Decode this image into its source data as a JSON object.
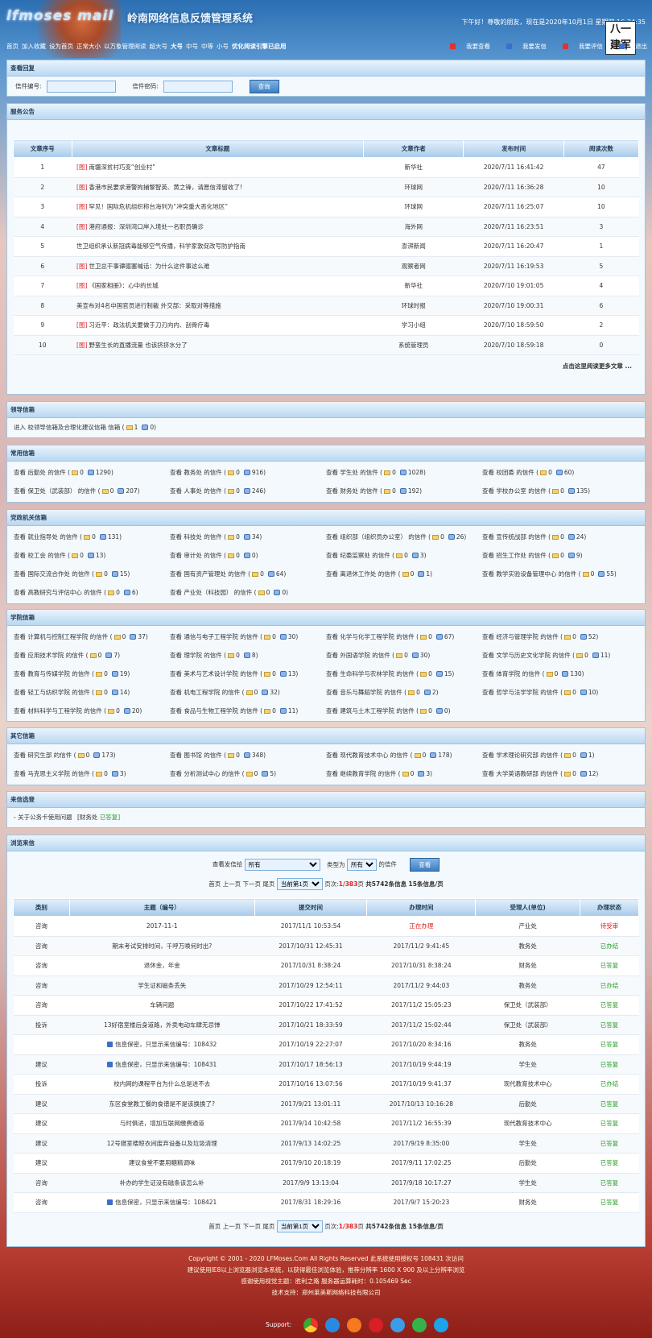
{
  "header": {
    "logo_text": "lfmoses mail",
    "system_title": "岭南网络信息反馈管理系统",
    "greeting": "下午好！尊敬的朋友，现在是2020年10月1日 星期四 16:34:35",
    "badge": "八一建军",
    "nav": [
      "首页",
      "加入收藏",
      "设为首页",
      "正常大小",
      "以万象管理阅读",
      "超大号",
      "大号",
      "中号",
      "中等",
      "小号",
      "优化阅读引擎已启用"
    ],
    "top_links": [
      "我要查看",
      "我要发信",
      "我要评信",
      "退出"
    ]
  },
  "search": {
    "title": "查看回复",
    "letter_no_label": "信件编号:",
    "password_label": "信件密码:",
    "button": "查询"
  },
  "notice": {
    "title": "服务公告",
    "columns": [
      "文章序号",
      "文章标题",
      "文章作者",
      "发布时间",
      "阅读次数"
    ],
    "rows": [
      {
        "no": "1",
        "tag": "[图]",
        "title": "南疆深贫村巧变“创业村”",
        "author": "新华社",
        "time": "2020/7/11 16:41:42",
        "reads": "47"
      },
      {
        "no": "2",
        "tag": "[图]",
        "title": "香港市民要求港警拘捕黎智英、黄之锋，请愿信滞留收了!",
        "author": "环球网",
        "time": "2020/7/11 16:36:28",
        "reads": "10"
      },
      {
        "no": "3",
        "tag": "[图]",
        "title": "罕见！国际危机组织称台海列为“冲突重大恶化地区”",
        "author": "环球网",
        "time": "2020/7/11 16:25:07",
        "reads": "10"
      },
      {
        "no": "4",
        "tag": "[图]",
        "title": "港府通报：深圳湾口岸入境处一名职员确诊",
        "author": "海外网",
        "time": "2020/7/11 16:23:51",
        "reads": "3"
      },
      {
        "no": "5",
        "tag": "",
        "title": "世卫组织承认新冠病毒能够空气传播，科学家敦促改写防护指南",
        "author": "澎湃新闻",
        "time": "2020/7/11 16:20:47",
        "reads": "1"
      },
      {
        "no": "6",
        "tag": "[图]",
        "title": "世卫总干事谭德塞喊话：为什么这件事这么难",
        "author": "观察者网",
        "time": "2020/7/11 16:19:53",
        "reads": "5"
      },
      {
        "no": "7",
        "tag": "[图]",
        "title": "《国家相册》：心中的长城",
        "author": "新华社",
        "time": "2020/7/10 19:01:05",
        "reads": "4"
      },
      {
        "no": "8",
        "tag": "",
        "title": "美宣布对4名中国官员进行制裁 外交部：采取对等措施",
        "author": "环球时报",
        "time": "2020/7/10 19:00:31",
        "reads": "6"
      },
      {
        "no": "9",
        "tag": "[图]",
        "title": "习近平：政法机关要做于刀刃向内、刮骨疗毒",
        "author": "学习小组",
        "time": "2020/7/10 18:59:50",
        "reads": "2"
      },
      {
        "no": "10",
        "tag": "[图]",
        "title": "野蛮生长的直播流量 也该挤挤水分了",
        "author": "系统管理员",
        "time": "2020/7/10 18:59:18",
        "reads": "0"
      }
    ],
    "more": "点击这里阅读更多文章 ..."
  },
  "leader": {
    "title": "领导信箱",
    "text": "进入 校领导信箱及合理化建议信箱 信箱 (",
    "mail": "1",
    "reply": "0"
  },
  "common": {
    "title": "常用信箱",
    "items": [
      {
        "name": "查看 后勤处 的信件 (",
        "a": "0",
        "b": "1290)"
      },
      {
        "name": "查看 教务处 的信件 (",
        "a": "0",
        "b": "916)"
      },
      {
        "name": "查看 学生处 的信件 (",
        "a": "0",
        "b": "1028)"
      },
      {
        "name": "查看 校团委 的信件 (",
        "a": "0",
        "b": "60)"
      },
      {
        "name": "查看 保卫处（武装部） 的信件 (",
        "a": "0",
        "b": "207)"
      },
      {
        "name": "查看 人事处 的信件 (",
        "a": "0",
        "b": "246)"
      },
      {
        "name": "查看 财务处 的信件 (",
        "a": "0",
        "b": "192)"
      },
      {
        "name": "查看 学校办公室 的信件 (",
        "a": "0",
        "b": "135)"
      }
    ]
  },
  "party": {
    "title": "党政机关信箱",
    "items": [
      {
        "name": "查看 就业指导处 的信件 (",
        "a": "0",
        "b": "131)"
      },
      {
        "name": "查看 科技处 的信件 (",
        "a": "0",
        "b": "34)"
      },
      {
        "name": "查看 组织部（组织员办公室） 的信件 (",
        "a": "0",
        "b": "26)"
      },
      {
        "name": "查看 宣传统战部 的信件 (",
        "a": "0",
        "b": "24)"
      },
      {
        "name": "查看 校工会 的信件 (",
        "a": "0",
        "b": "13)"
      },
      {
        "name": "查看 审计处 的信件 (",
        "a": "0",
        "b": "0)"
      },
      {
        "name": "查看 纪委监察处 的信件 (",
        "a": "0",
        "b": "3)"
      },
      {
        "name": "查看 招生工作处 的信件 (",
        "a": "0",
        "b": "9)"
      },
      {
        "name": "查看 国际交流合作处 的信件 (",
        "a": "0",
        "b": "15)"
      },
      {
        "name": "查看 国有资产管理处 的信件 (",
        "a": "0",
        "b": "64)"
      },
      {
        "name": "查看 离退休工作处 的信件 (",
        "a": "0",
        "b": "1)"
      },
      {
        "name": "查看 教学实验设备管理中心 的信件 (",
        "a": "0",
        "b": "55)"
      },
      {
        "name": "查看 高教研究与评估中心 的信件 (",
        "a": "0",
        "b": "6)"
      },
      {
        "name": "查看 产业处（科技园） 的信件 (",
        "a": "0",
        "b": "0)"
      }
    ]
  },
  "college": {
    "title": "学院信箱",
    "items": [
      {
        "name": "查看 计算机与控制工程学院 的信件 (",
        "a": "0",
        "b": "37)"
      },
      {
        "name": "查看 通信与电子工程学院 的信件 (",
        "a": "0",
        "b": "30)"
      },
      {
        "name": "查看 化学与化学工程学院 的信件 (",
        "a": "0",
        "b": "67)"
      },
      {
        "name": "查看 经济与管理学院 的信件 (",
        "a": "0",
        "b": "52)"
      },
      {
        "name": "查看 应用技术学院 的信件 (",
        "a": "0",
        "b": "7)"
      },
      {
        "name": "查看 理学院 的信件 (",
        "a": "0",
        "b": "8)"
      },
      {
        "name": "查看 外国语学院 的信件 (",
        "a": "0",
        "b": "30)"
      },
      {
        "name": "查看 文学与历史文化学院 的信件 (",
        "a": "0",
        "b": "11)"
      },
      {
        "name": "查看 教育与传媒学院 的信件 (",
        "a": "0",
        "b": "19)"
      },
      {
        "name": "查看 美术与艺术设计学院 的信件 (",
        "a": "0",
        "b": "13)"
      },
      {
        "name": "查看 生命科学与农林学院 的信件 (",
        "a": "0",
        "b": "15)"
      },
      {
        "name": "查看 体育学院 的信件 (",
        "a": "0",
        "b": "130)"
      },
      {
        "name": "查看 轻工与纺织学院 的信件 (",
        "a": "0",
        "b": "14)"
      },
      {
        "name": "查看 机电工程学院 的信件 (",
        "a": "0",
        "b": "32)"
      },
      {
        "name": "查看 音乐与舞蹈学院 的信件 (",
        "a": "0",
        "b": "2)"
      },
      {
        "name": "查看 哲学与法学学院 的信件 (",
        "a": "0",
        "b": "10)"
      },
      {
        "name": "查看 材料科学与工程学院 的信件 (",
        "a": "0",
        "b": "20)"
      },
      {
        "name": "查看 食品与生物工程学院 的信件 (",
        "a": "0",
        "b": "11)"
      },
      {
        "name": "查看 建筑与土木工程学院 的信件 (",
        "a": "0",
        "b": "0)"
      }
    ]
  },
  "other": {
    "title": "其它信箱",
    "items": [
      {
        "name": "查看 研究生部 的信件 (",
        "a": "0",
        "b": "173)"
      },
      {
        "name": "查看 图书馆 的信件 (",
        "a": "0",
        "b": "348)"
      },
      {
        "name": "查看 现代教育技术中心 的信件 (",
        "a": "0",
        "b": "178)"
      },
      {
        "name": "查看 学术理论研究部 的信件 (",
        "a": "0",
        "b": "1)"
      },
      {
        "name": "查看 马克思主义学院 的信件 (",
        "a": "0",
        "b": "3)"
      },
      {
        "name": "查看 分析测试中心 的信件 (",
        "a": "0",
        "b": "5)"
      },
      {
        "name": "查看 继续教育学院 的信件 (",
        "a": "0",
        "b": "3)"
      },
      {
        "name": "查看 大学英语教研部 的信件 (",
        "a": "0",
        "b": "12)"
      }
    ]
  },
  "featured": {
    "title": "来信选登",
    "text": "- 关于公务卡使用问题",
    "dept": "[财务处",
    "status": "已答复]"
  },
  "browse": {
    "title": "浏览来信",
    "filter_label": "查看发信给",
    "filter_value": "所有",
    "type_label": "类型为",
    "type_value": "所有",
    "suffix": "的信件",
    "button": "查看",
    "pager": {
      "links": "首页 上一页 下一页 尾页",
      "select": "当前第1页",
      "page_label": "页次:",
      "page": "1/383",
      "page_unit": "页",
      "total": "共5742条信息",
      "per": "15条信息/页"
    },
    "columns": [
      "类别",
      "主题（编号）",
      "提交时间",
      "办理时间",
      "受理人(单位)",
      "办理状态"
    ],
    "rows": [
      {
        "type": "咨询",
        "lock": false,
        "subject": "2017-11-1",
        "submit": "2017/11/1 10:53:54",
        "handle": "正在办理",
        "handle_red": true,
        "dept": "产业处",
        "status": "待受审",
        "status_cls": "red"
      },
      {
        "type": "咨询",
        "lock": false,
        "subject": "期末考试安排时间，千呼万唤何时出?",
        "submit": "2017/10/31 12:45:31",
        "handle": "2017/11/2 9:41:45",
        "handle_red": false,
        "dept": "教务处",
        "status": "已办结",
        "status_cls": "green"
      },
      {
        "type": "咨询",
        "lock": false,
        "subject": "退休金，年金",
        "submit": "2017/10/31 8:38:24",
        "handle": "2017/10/31 8:38:24",
        "handle_red": false,
        "dept": "财务处",
        "status": "已答复",
        "status_cls": "green"
      },
      {
        "type": "咨询",
        "lock": false,
        "subject": "学生证和磁条丢失",
        "submit": "2017/10/29 12:54:11",
        "handle": "2017/11/2 9:44:03",
        "handle_red": false,
        "dept": "教务处",
        "status": "已办结",
        "status_cls": "green"
      },
      {
        "type": "咨询",
        "lock": false,
        "subject": "车辆问题",
        "submit": "2017/10/22 17:41:52",
        "handle": "2017/11/2 15:05:23",
        "handle_red": false,
        "dept": "保卫处（武装部）",
        "status": "已答复",
        "status_cls": "green"
      },
      {
        "type": "投诉",
        "lock": false,
        "subject": "13好宿室楼后身道路，外卖电动车肆无忌惮",
        "submit": "2017/10/21 18:33:59",
        "handle": "2017/11/2 15:02:44",
        "handle_red": false,
        "dept": "保卫处（武装部）",
        "status": "已答复",
        "status_cls": "green"
      },
      {
        "type": "",
        "lock": true,
        "subject": "信息保密，只显示来信编号：108432",
        "submit": "2017/10/19 22:27:07",
        "handle": "2017/10/20 8:34:16",
        "handle_red": false,
        "dept": "教务处",
        "status": "已答复",
        "status_cls": "green"
      },
      {
        "type": "建议",
        "lock": true,
        "subject": "信息保密，只显示来信编号：108431",
        "submit": "2017/10/17 18:56:13",
        "handle": "2017/10/19 9:44:19",
        "handle_red": false,
        "dept": "学生处",
        "status": "已答复",
        "status_cls": "green"
      },
      {
        "type": "投诉",
        "lock": false,
        "subject": "校内网的课程平台为什么总是进不去",
        "submit": "2017/10/16 13:07:56",
        "handle": "2017/10/19 9:41:37",
        "handle_red": false,
        "dept": "现代教育技术中心",
        "status": "已办结",
        "status_cls": "green"
      },
      {
        "type": "建议",
        "lock": false,
        "subject": "东区食堂教工餐的食谱是不是该换换了?",
        "submit": "2017/9/21 13:01:11",
        "handle": "2017/10/13 10:16:28",
        "handle_red": false,
        "dept": "后勤处",
        "status": "已答复",
        "status_cls": "green"
      },
      {
        "type": "建议",
        "lock": false,
        "subject": "与时俱进，增加互联网缴费通道",
        "submit": "2017/9/14 10:42:58",
        "handle": "2017/11/2 16:55:39",
        "handle_red": false,
        "dept": "现代教育技术中心",
        "status": "已答复",
        "status_cls": "green"
      },
      {
        "type": "建议",
        "lock": false,
        "subject": "12号寝室楼晾衣间废弃设备以及垃圾清理",
        "submit": "2017/9/13 14:02:25",
        "handle": "2017/9/19 8:35:00",
        "handle_red": false,
        "dept": "学生处",
        "status": "已答复",
        "status_cls": "green"
      },
      {
        "type": "建议",
        "lock": false,
        "subject": "建议食堂不要用糖精调味",
        "submit": "2017/9/10 20:18:19",
        "handle": "2017/9/11 17:02:25",
        "handle_red": false,
        "dept": "后勤处",
        "status": "已答复",
        "status_cls": "green"
      },
      {
        "type": "咨询",
        "lock": false,
        "subject": "补办的学生证没有磁条该怎么补",
        "submit": "2017/9/9 13:13:04",
        "handle": "2017/9/18 10:17:27",
        "handle_red": false,
        "dept": "学生处",
        "status": "已答复",
        "status_cls": "green"
      },
      {
        "type": "咨询",
        "lock": true,
        "subject": "信息保密，只显示来信编号：108421",
        "submit": "2017/8/31 18:29:16",
        "handle": "2017/9/7 15:20:23",
        "handle_red": false,
        "dept": "财务处",
        "status": "已答复",
        "status_cls": "green"
      }
    ]
  },
  "footer": {
    "lines": [
      "Copyright © 2001 - 2020 LFMoses.Com All Rights Reserved 此系统使用授权号 108431 次访问",
      "建议使用IE8以上浏览器浏览本系统，以获得最佳浏览体验，推荐分辨率 1600 X 900 及以上分辨率浏览",
      "感谢使用视觉主题：胜利之路   服务器运算耗时：0.105469 Sec",
      "技术支持：郑州莱美斯网络科技有限公司"
    ],
    "support": "Support:"
  }
}
